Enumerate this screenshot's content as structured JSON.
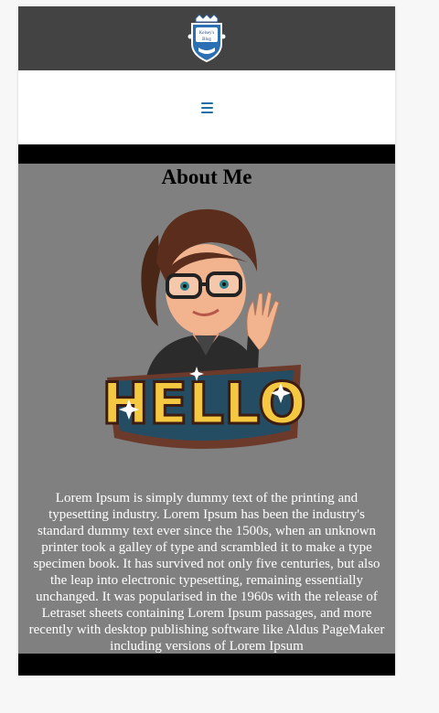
{
  "header": {
    "logo_icon": "crest-logo-icon",
    "logo_text_line1": "Kelsey's",
    "logo_text_line2": "Blog"
  },
  "nav": {
    "menu_icon": "hamburger-menu-icon",
    "menu_color": "#1c6ea4"
  },
  "about": {
    "title": "About Me",
    "image_icon": "bitmoji-hello-avatar",
    "image_word": "HELLO",
    "paragraph": "Lorem Ipsum is simply dummy text of the printing and typesetting industry. Lorem Ipsum has been the industry's standard dummy text ever since the 1500s, when an unknown printer took a galley of type and scrambled it to make a type specimen book. It has survived not only five centuries, but also the leap into electronic typesetting, remaining essentially unchanged. It was popularised in the 1960s with the release of Letraset sheets containing Lorem Ipsum passages, and more recently with desktop publishing software like Aldus PageMaker including versions of Lorem Ipsum"
  },
  "colors": {
    "topbar": "#434343",
    "content_bg": "#808080",
    "stripe": "#000000"
  }
}
